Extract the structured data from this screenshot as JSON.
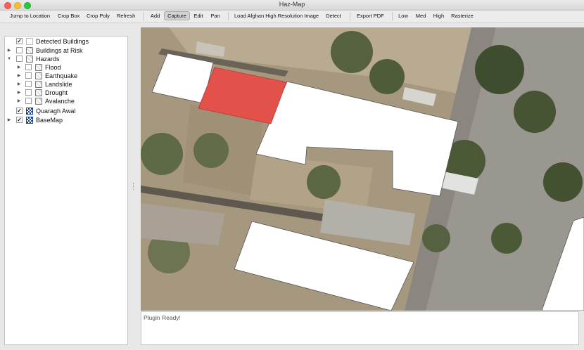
{
  "window": {
    "title": "Haz-Map"
  },
  "toolbar": {
    "buttons": [
      {
        "label": "Jump to Location"
      },
      {
        "label": "Crop Box"
      },
      {
        "label": "Crop Poly"
      },
      {
        "label": "Refresh"
      },
      {
        "label": "Add"
      },
      {
        "label": "Capture",
        "active": true
      },
      {
        "label": "Edit"
      },
      {
        "label": "Pan"
      },
      {
        "label": "Load Afghan High Resolution Image"
      },
      {
        "label": "Detect"
      },
      {
        "label": "Export PDF"
      },
      {
        "label": "Low"
      },
      {
        "label": "Med"
      },
      {
        "label": "High"
      },
      {
        "label": "Rasterize"
      }
    ]
  },
  "layers": [
    {
      "label": "Detected Buildings",
      "checked": true,
      "icon": "polygon-layer-icon",
      "expander": ""
    },
    {
      "label": "Buildings at Risk",
      "checked": false,
      "icon": "group-icon",
      "expander": "right"
    },
    {
      "label": "Hazards",
      "checked": false,
      "icon": "group-icon",
      "expander": "down"
    },
    {
      "label": "Flood",
      "checked": false,
      "icon": "group-icon",
      "expander": "right"
    },
    {
      "label": "Earthquake",
      "checked": false,
      "icon": "group-icon",
      "expander": "right"
    },
    {
      "label": "Landslide",
      "checked": false,
      "icon": "group-icon",
      "expander": "right"
    },
    {
      "label": "Drought",
      "checked": false,
      "icon": "group-icon",
      "expander": "right"
    },
    {
      "label": "Avalanche",
      "checked": false,
      "icon": "group-icon",
      "expander": "right"
    },
    {
      "label": "Quaragh Awal",
      "checked": true,
      "icon": "raster-layer-icon",
      "expander": ""
    },
    {
      "label": "BaseMap",
      "checked": true,
      "icon": "raster-layer-icon",
      "expander": "right"
    }
  ],
  "status": {
    "message": "Plugin Ready!"
  },
  "colors": {
    "selected_building": "#e3524a",
    "detected_building": "#ffffff"
  }
}
